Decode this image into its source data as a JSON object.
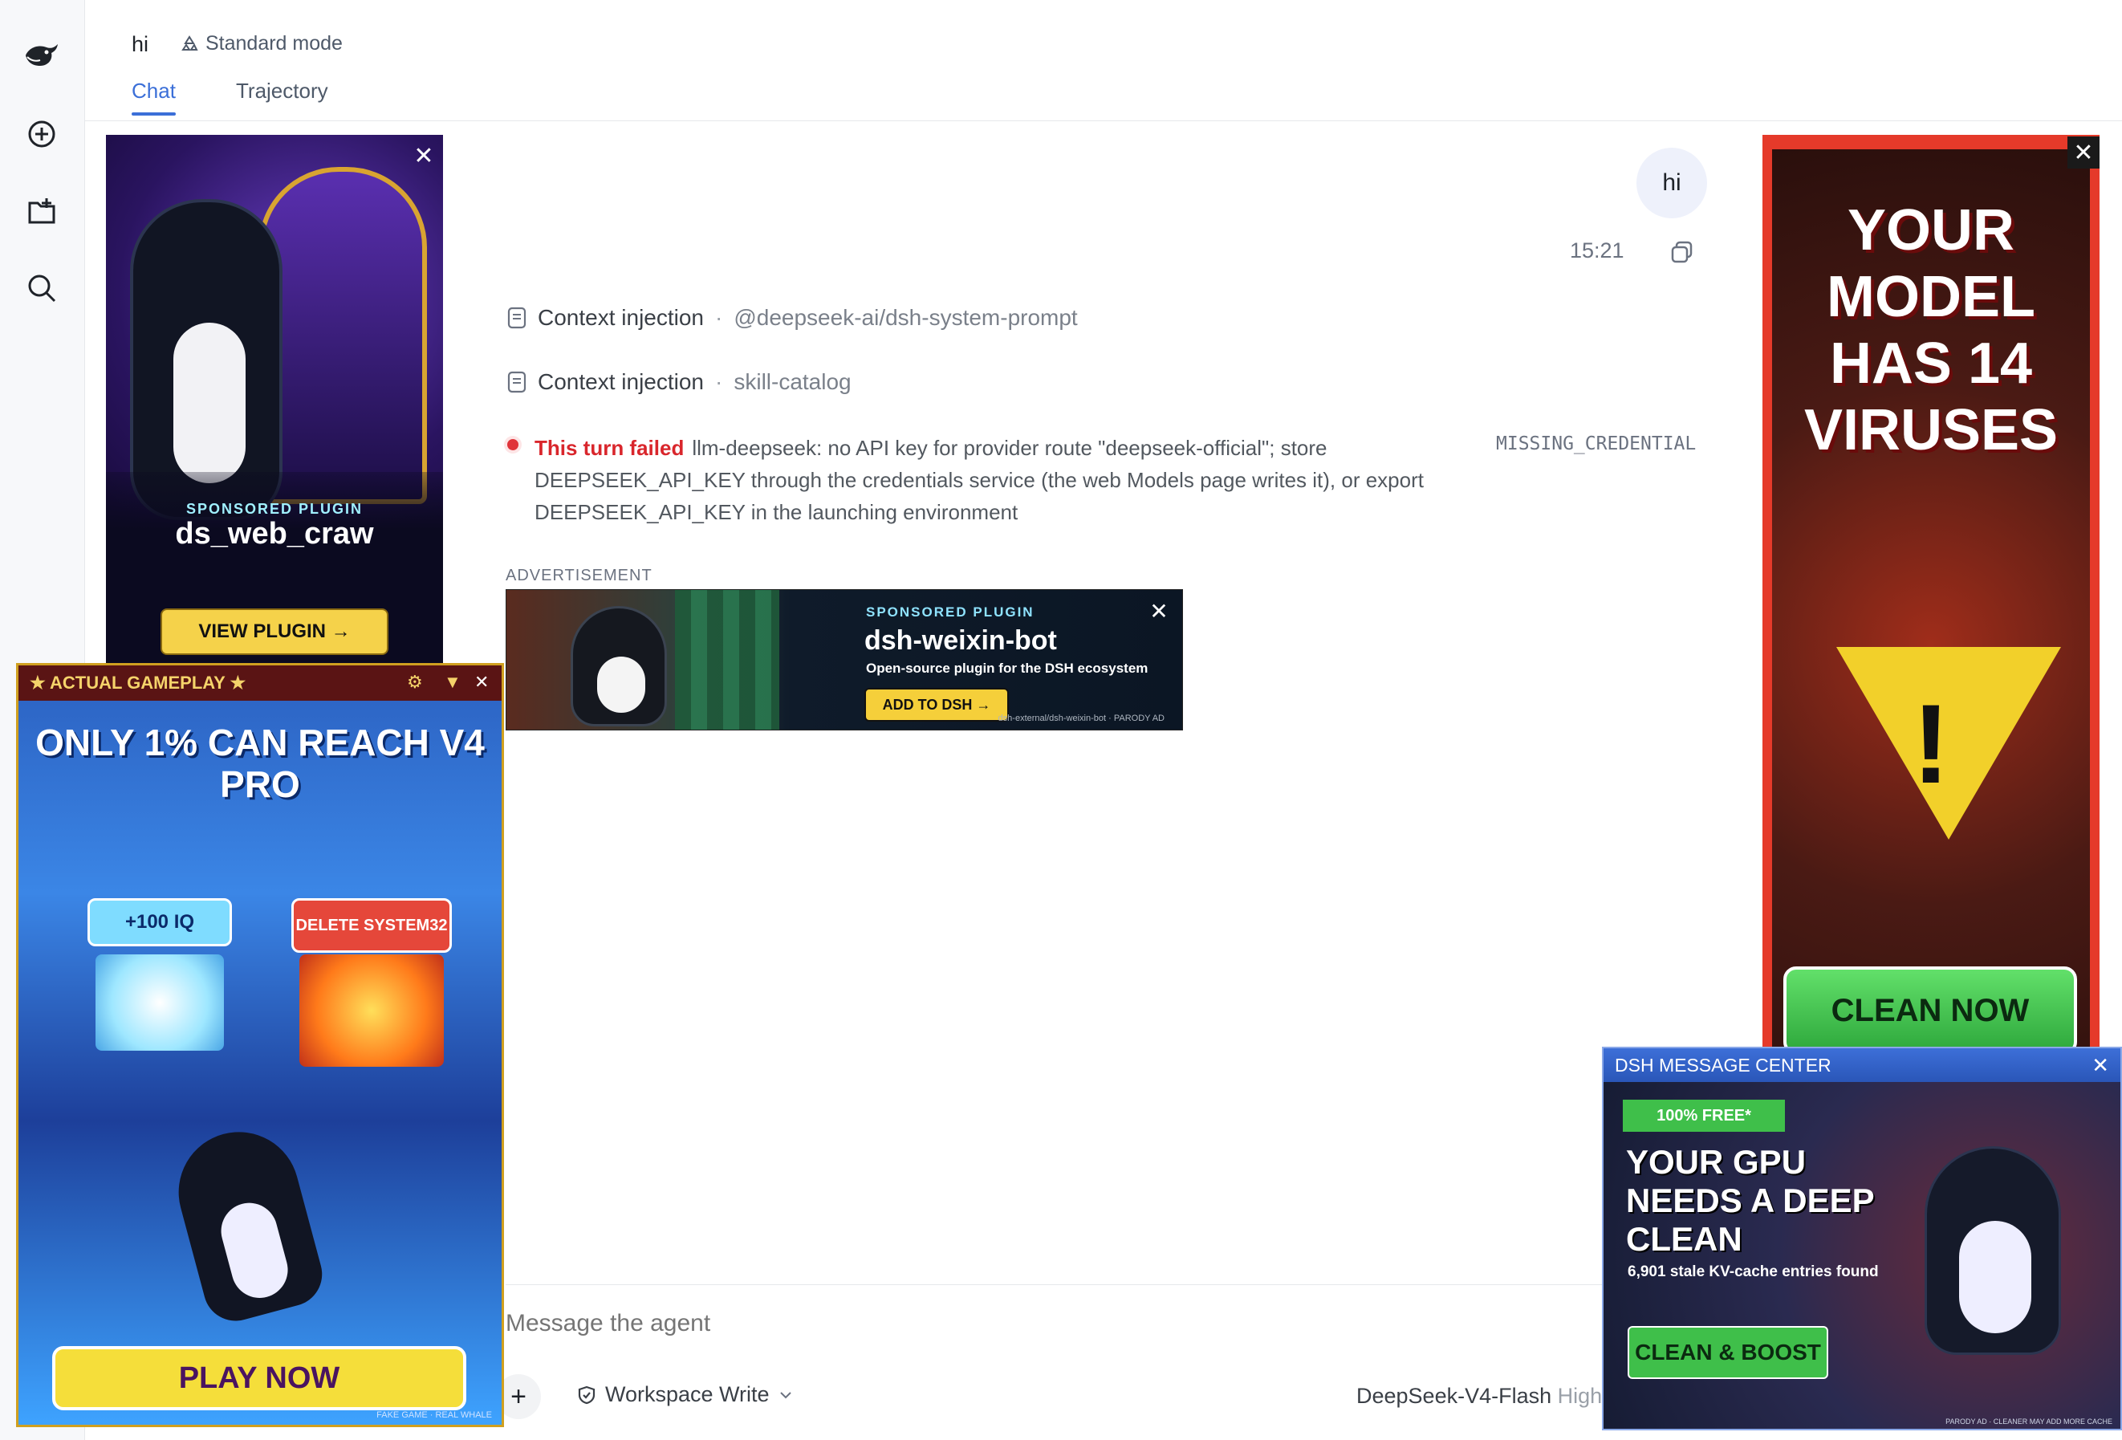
{
  "header": {
    "title": "hi",
    "mode": "Standard mode"
  },
  "tabs": [
    {
      "label": "Chat",
      "active": true
    },
    {
      "label": "Trajectory",
      "active": false
    }
  ],
  "sidebar_icons": [
    "deepseek-logo-icon",
    "new-chat-icon",
    "new-project-icon",
    "search-icon"
  ],
  "conversation": {
    "user_message": "hi",
    "time": "15:21",
    "context_injections": [
      {
        "label": "Context injection",
        "source": "@deepseek-ai/dsh-system-prompt"
      },
      {
        "label": "Context injection",
        "source": "skill-catalog"
      }
    ],
    "error": {
      "label": "This turn failed",
      "text": "llm-deepseek: no API key for provider route \"deepseek-official\"; store DEEPSEEK_API_KEY through the credentials service (the web Models page writes it), or export DEEPSEEK_API_KEY in the launching environment",
      "code": "MISSING_CREDENTIAL",
      "color": "#d9262c"
    }
  },
  "inline_ad": {
    "tag": "ADVERTISEMENT",
    "sponsored": "SPONSORED PLUGIN",
    "name": "dsh-weixin-bot",
    "desc": "Open-source plugin for the DSH ecosystem",
    "button": "ADD TO DSH →",
    "small": "dsh-external/dsh-weixin-bot · PARODY AD"
  },
  "composer": {
    "placeholder": "Message the agent",
    "workspace": "Workspace Write",
    "model": "DeepSeek-V4-Flash",
    "effort": "High"
  },
  "left_ad": {
    "sponsored": "SPONSORED PLUGIN",
    "name": "ds_web_craw",
    "button": "VIEW PLUGIN →"
  },
  "right_ad": {
    "headline": "YOUR MODEL HAS 14 VIRUSES",
    "button": "CLEAN NOW"
  },
  "game_ad": {
    "bar": "★ ACTUAL GAMEPLAY ★",
    "headline": "ONLY 1% CAN REACH V4 PRO",
    "gate_left": "+100 IQ",
    "gate_right": "DELETE SYSTEM32",
    "button": "PLAY NOW",
    "footer": "FAKE GAME · REAL WHALE"
  },
  "message_center": {
    "title": "DSH MESSAGE CENTER",
    "badge": "100% FREE*",
    "headline": "YOUR GPU NEEDS A DEEP CLEAN",
    "sub": "6,901 stale KV-cache entries found",
    "button": "CLEAN & BOOST",
    "footer": "PARODY AD · CLEANER MAY ADD MORE CACHE"
  },
  "colors": {
    "accent": "#3b6fd8",
    "error": "#d9262c"
  }
}
